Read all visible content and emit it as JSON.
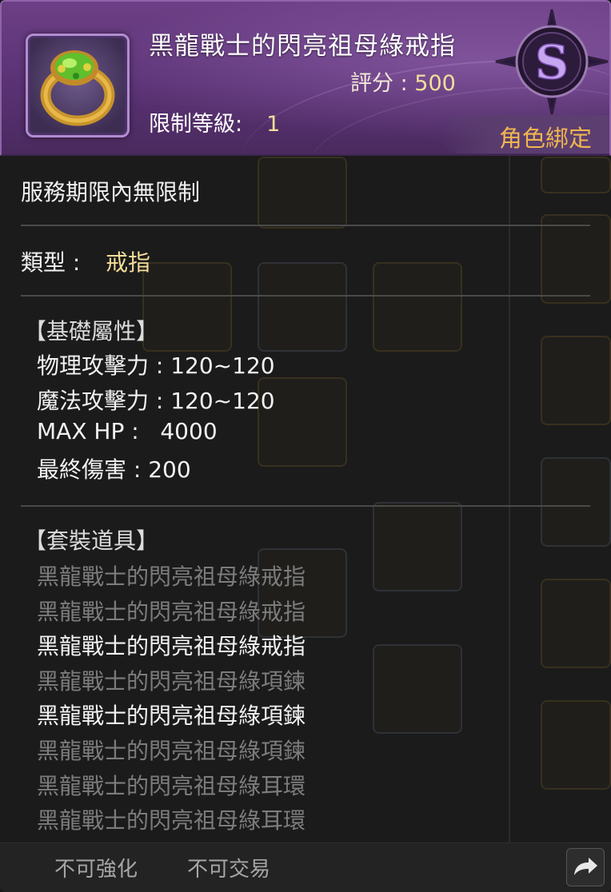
{
  "item": {
    "name": "黑龍戰士的閃亮祖母綠戒指",
    "score_label": "評分 : ",
    "score_value": "500",
    "level_label": "限制等級:",
    "level_value": "1",
    "binding": "角色綁定",
    "grade": "S",
    "icon": "emerald-ring-icon"
  },
  "service_period": "服務期限內無限制",
  "type": {
    "label": "類型 :",
    "value": "戒指"
  },
  "basic_attributes": {
    "header": "【基礎屬性】",
    "stats": [
      "物理攻擊力 : 120~120",
      "魔法攻擊力 : 120~120",
      "MAX HP :   4000",
      "最終傷害 : 200"
    ]
  },
  "set_items": {
    "header": "【套裝道具】",
    "items": [
      {
        "name": "黑龍戰士的閃亮祖母綠戒指",
        "equipped": false
      },
      {
        "name": "黑龍戰士的閃亮祖母綠戒指",
        "equipped": false
      },
      {
        "name": "黑龍戰士的閃亮祖母綠戒指",
        "equipped": true
      },
      {
        "name": "黑龍戰士的閃亮祖母綠項鍊",
        "equipped": false
      },
      {
        "name": "黑龍戰士的閃亮祖母綠項鍊",
        "equipped": true
      },
      {
        "name": "黑龍戰士的閃亮祖母綠項鍊",
        "equipped": false
      },
      {
        "name": "黑龍戰士的閃亮祖母綠耳環",
        "equipped": false
      },
      {
        "name": "黑龍戰士的閃亮祖母綠耳環",
        "equipped": false
      }
    ]
  },
  "footer": {
    "tags": [
      "不可強化",
      "不可交易"
    ],
    "share_icon": "share-arrow-icon"
  },
  "colors": {
    "header_purple": "#5a3274",
    "gold_text": "#f4dd9a",
    "binding_orange": "#f0b64f",
    "inactive_grey": "#7c7c7c"
  }
}
